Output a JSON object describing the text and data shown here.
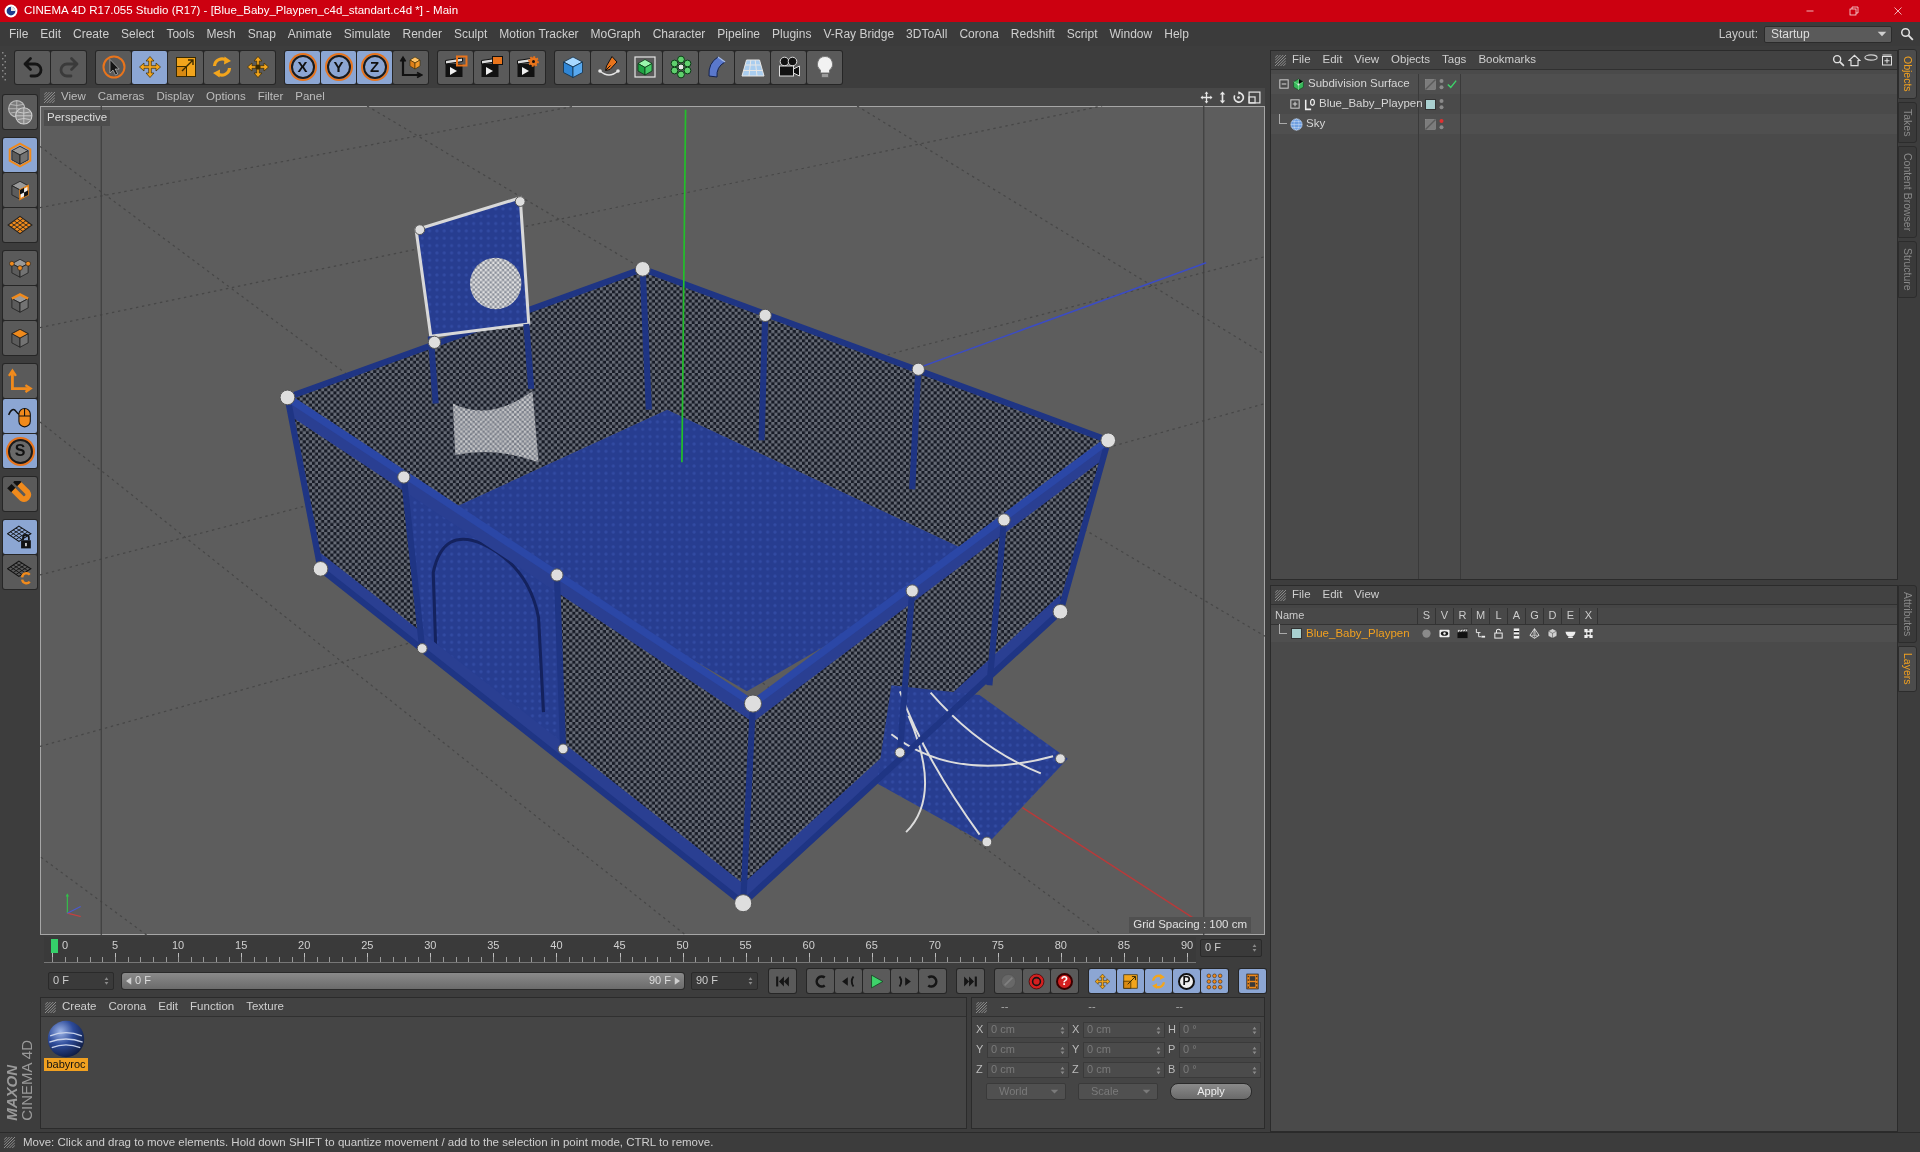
{
  "window": {
    "title": "CINEMA 4D R17.055 Studio (R17) - [Blue_Baby_Playpen_c4d_standart.c4d *] - Main"
  },
  "menu_bar": [
    "File",
    "Edit",
    "Create",
    "Select",
    "Tools",
    "Mesh",
    "Snap",
    "Animate",
    "Simulate",
    "Render",
    "Sculpt",
    "Motion Tracker",
    "MoGraph",
    "Character",
    "Pipeline",
    "Plugins",
    "V-Ray Bridge",
    "3DToAll",
    "Corona",
    "Redshift",
    "Script",
    "Window",
    "Help"
  ],
  "layout": {
    "label": "Layout:",
    "value": "Startup"
  },
  "toolbar": [
    [
      {
        "kind": "undo",
        "disabled": false
      },
      {
        "kind": "redo",
        "disabled": true
      }
    ],
    [
      {
        "kind": "select",
        "selected": false
      },
      {
        "kind": "move",
        "selected": true
      },
      {
        "kind": "scale",
        "selected": false
      },
      {
        "kind": "rotate",
        "selected": false
      },
      {
        "kind": "transform",
        "selected": false
      }
    ],
    [
      {
        "kind": "axis-lock",
        "label": "X",
        "selected": true
      },
      {
        "kind": "axis-lock",
        "label": "Y",
        "selected": true
      },
      {
        "kind": "axis-lock",
        "label": "Z",
        "selected": true
      },
      {
        "kind": "coords",
        "selected": false
      }
    ],
    [
      {
        "kind": "render-view"
      },
      {
        "kind": "render-picture"
      },
      {
        "kind": "render-settings"
      }
    ],
    [
      {
        "kind": "cube"
      },
      {
        "kind": "pen"
      },
      {
        "kind": "subdivision"
      },
      {
        "kind": "cloner"
      },
      {
        "kind": "bend"
      },
      {
        "kind": "floor"
      },
      {
        "kind": "camera"
      },
      {
        "kind": "light"
      }
    ]
  ],
  "mode_toolbar": [
    [
      {
        "kind": "make-editable"
      }
    ],
    [
      {
        "kind": "model",
        "selected": true
      },
      {
        "kind": "texture",
        "selected": false
      },
      {
        "kind": "workplane",
        "selected": false
      }
    ],
    [
      {
        "kind": "points",
        "selected": false
      },
      {
        "kind": "edges",
        "selected": false
      },
      {
        "kind": "polygons",
        "selected": false
      }
    ],
    [
      {
        "kind": "axis",
        "selected": false
      },
      {
        "kind": "tweak",
        "selected": true
      },
      {
        "kind": "snap",
        "label": "S",
        "selected": true
      }
    ],
    [
      {
        "kind": "magnet",
        "selected": false
      }
    ],
    [
      {
        "kind": "lock-workplane",
        "selected": true
      },
      {
        "kind": "align-workplane",
        "selected": false
      }
    ]
  ],
  "viewport": {
    "menu": [
      "View",
      "Cameras",
      "Display",
      "Options",
      "Filter",
      "Panel"
    ],
    "camera": "Perspective",
    "grid_spacing": "Grid Spacing : 100 cm"
  },
  "object_manager": {
    "menu": [
      "File",
      "Edit",
      "View",
      "Objects",
      "Tags",
      "Bookmarks"
    ],
    "objects": [
      {
        "name": "Subdivision Surface",
        "kind": "generator",
        "expanded": true,
        "editor_visible": true,
        "enabled": true,
        "children": [
          {
            "name": "Blue_Baby_Playpen",
            "kind": "null",
            "expanded": false,
            "color": "#a9d0d0",
            "editor_visible": true
          }
        ]
      },
      {
        "name": "Sky",
        "kind": "sky",
        "editor_visible": false
      }
    ]
  },
  "side_tabs": [
    [
      {
        "label": "Objects",
        "selected": true
      },
      {
        "label": "Takes",
        "selected": false
      },
      {
        "label": "Content Browser",
        "selected": false
      },
      {
        "label": "Structure",
        "selected": false
      }
    ],
    [
      {
        "label": "Attributes",
        "selected": false
      },
      {
        "label": "Layers",
        "selected": true
      }
    ]
  ],
  "layer_manager": {
    "menu": [
      "File",
      "Edit",
      "View"
    ],
    "columns": [
      "Name",
      "S",
      "V",
      "R",
      "M",
      "L",
      "A",
      "G",
      "D",
      "E",
      "X"
    ],
    "layers": [
      {
        "name": "Blue_Baby_Playpen",
        "color": "#a9d0d0",
        "selected": true
      }
    ]
  },
  "timeline": {
    "ticks": [
      "0",
      "5",
      "10",
      "15",
      "20",
      "25",
      "30",
      "35",
      "40",
      "45",
      "50",
      "55",
      "60",
      "65",
      "70",
      "75",
      "80",
      "85",
      "90"
    ],
    "current_frame": "0 F"
  },
  "transport": {
    "start": "0 F",
    "range": {
      "start_label": "0 F",
      "end_label": "90 F",
      "level": 1
    },
    "end": "90 F",
    "buttons": [
      [
        {
          "kind": "go-start"
        }
      ],
      [
        {
          "kind": "prev-key"
        },
        {
          "kind": "prev-frame"
        },
        {
          "kind": "play"
        },
        {
          "kind": "next-frame"
        },
        {
          "kind": "next-key"
        }
      ],
      [
        {
          "kind": "go-end"
        }
      ],
      [
        {
          "kind": "autokey",
          "disabled": true
        },
        {
          "kind": "record",
          "disabled": false
        },
        {
          "kind": "key-info",
          "label": "?",
          "disabled": false
        }
      ],
      [
        {
          "kind": "key-move",
          "selected": true
        },
        {
          "kind": "key-scale",
          "selected": true
        },
        {
          "kind": "key-rotate",
          "selected": true
        },
        {
          "kind": "key-param",
          "label": "P",
          "selected": true
        },
        {
          "kind": "key-points",
          "selected": true
        }
      ],
      [
        {
          "kind": "timeline",
          "selected": true
        }
      ]
    ]
  },
  "material_manager": {
    "menu": [
      "Create",
      "Corona",
      "Edit",
      "Function",
      "Texture"
    ],
    "materials": [
      {
        "name": "babyroc",
        "selected": true
      }
    ]
  },
  "coordinates": {
    "headers": [
      "--",
      "--",
      "--"
    ],
    "disabled": true,
    "rows": [
      {
        "position_axis": "X",
        "position": "0 cm",
        "size_axis": "X",
        "size": "0 cm",
        "rotation_axis": "H",
        "rotation": "0 °"
      },
      {
        "position_axis": "Y",
        "position": "0 cm",
        "size_axis": "Y",
        "size": "0 cm",
        "rotation_axis": "P",
        "rotation": "0 °"
      },
      {
        "position_axis": "Z",
        "position": "0 cm",
        "size_axis": "Z",
        "size": "0 cm",
        "rotation_axis": "B",
        "rotation": "0 °"
      }
    ],
    "space": "World",
    "mode": "Scale",
    "apply": "Apply"
  },
  "status_bar": {
    "text": "Move: Click and drag to move elements. Hold down SHIFT to quantize movement / add to the selection in point mode, CTRL to remove."
  },
  "logo": {
    "brand": "MAXON",
    "product": "CINEMA 4D"
  }
}
